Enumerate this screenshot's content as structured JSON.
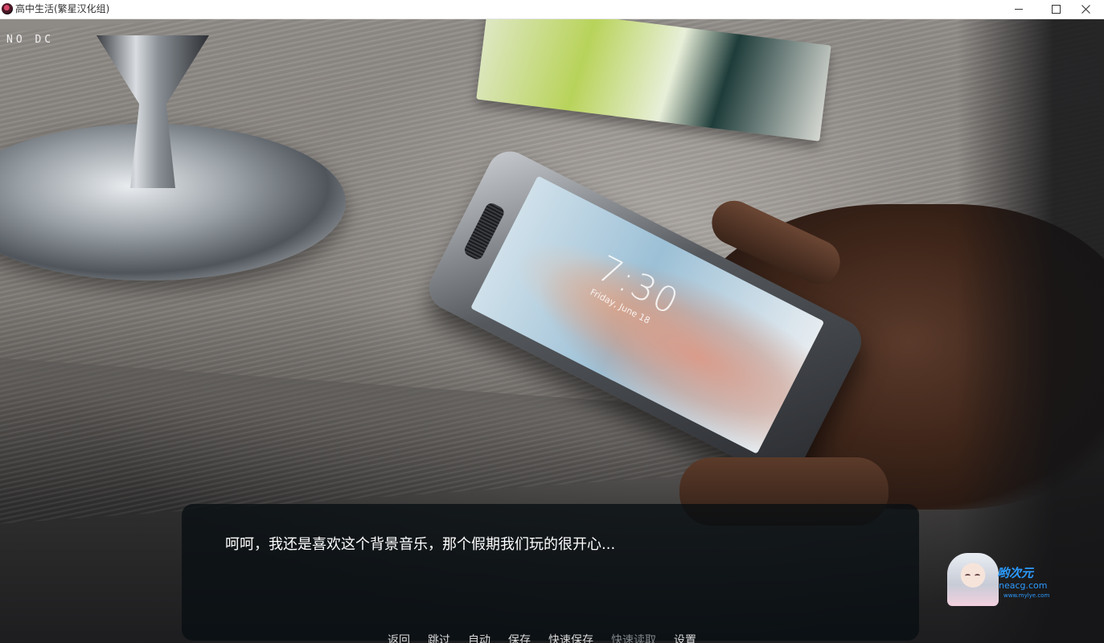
{
  "window": {
    "title": "高中生活(繁星汉化组)",
    "controls": {
      "minimize_icon": "minimize-icon",
      "maximize_icon": "maximize-icon",
      "close_icon": "close-icon"
    }
  },
  "scene": {
    "debug_label": "NO DC",
    "phone_lock_time": "7:30",
    "phone_lock_date": "Friday, June 18"
  },
  "dialogue": {
    "text": "呵呵，我还是喜欢这个背景音乐，那个假期我们玩的很开心..."
  },
  "quick_menu": [
    {
      "label": "返回",
      "enabled": true
    },
    {
      "label": "跳过",
      "enabled": true
    },
    {
      "label": "自动",
      "enabled": true
    },
    {
      "label": "保存",
      "enabled": true
    },
    {
      "label": "快速保存",
      "enabled": true
    },
    {
      "label": "快速读取",
      "enabled": false
    },
    {
      "label": "设置",
      "enabled": true
    }
  ],
  "watermark": {
    "name": "哟次元",
    "site": "neacg.com",
    "sub": "www.mylye.com"
  },
  "colors": {
    "dialogue_bg": "#080e12",
    "menu_text": "#d9d9d9",
    "menu_disabled": "#7f868b",
    "watermark_blue": "#2b9bff"
  }
}
